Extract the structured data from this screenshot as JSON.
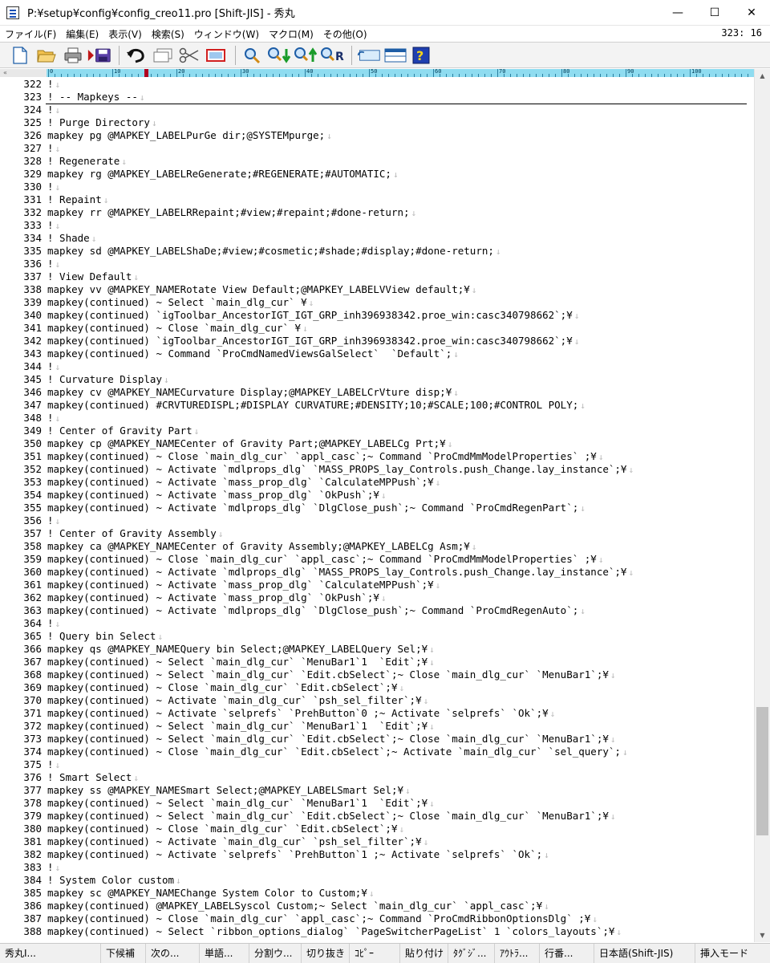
{
  "window": {
    "title": "P:¥setup¥config¥config_creo11.pro  [Shift-JIS] - 秀丸",
    "minimize": "—",
    "maximize": "☐",
    "close": "✕"
  },
  "menu": {
    "items": [
      "ファイル(F)",
      "編集(E)",
      "表示(V)",
      "検索(S)",
      "ウィンドウ(W)",
      "マクロ(M)",
      "その他(O)"
    ],
    "cursor_position": "323: 16"
  },
  "toolbar": {
    "icons": [
      "new-file-icon",
      "open-folder-icon",
      "print-icon",
      "save-icon",
      "undo-icon",
      "copy-icon",
      "cut-icon",
      "paste-icon",
      "search-icon",
      "search-down-icon",
      "search-up-icon",
      "replace-icon",
      "window-switch-icon",
      "window-split-icon",
      "help-icon"
    ]
  },
  "ruler": {
    "left_marker": "«",
    "labels": [
      "0",
      "10",
      "20",
      "30",
      "40",
      "50",
      "60",
      "70",
      "80",
      "90",
      "100"
    ]
  },
  "editor": {
    "eol_mark": "↓",
    "lines": [
      {
        "n": "322",
        "t": "!"
      },
      {
        "n": "323",
        "t": "! -- Mapkeys --"
      },
      {
        "n": "324",
        "t": "!"
      },
      {
        "n": "325",
        "t": "! Purge Directory"
      },
      {
        "n": "326",
        "t": "mapkey pg @MAPKEY_LABELPurGe dir;@SYSTEMpurge;"
      },
      {
        "n": "327",
        "t": "!"
      },
      {
        "n": "328",
        "t": "! Regenerate"
      },
      {
        "n": "329",
        "t": "mapkey rg @MAPKEY_LABELReGenerate;#REGENERATE;#AUTOMATIC;"
      },
      {
        "n": "330",
        "t": "!"
      },
      {
        "n": "331",
        "t": "! Repaint"
      },
      {
        "n": "332",
        "t": "mapkey rr @MAPKEY_LABELRRepaint;#view;#repaint;#done-return;"
      },
      {
        "n": "333",
        "t": "!"
      },
      {
        "n": "334",
        "t": "! Shade"
      },
      {
        "n": "335",
        "t": "mapkey sd @MAPKEY_LABELShaDe;#view;#cosmetic;#shade;#display;#done-return;"
      },
      {
        "n": "336",
        "t": "!"
      },
      {
        "n": "337",
        "t": "! View Default"
      },
      {
        "n": "338",
        "t": "mapkey vv @MAPKEY_NAMERotate View Default;@MAPKEY_LABELVView default;¥"
      },
      {
        "n": "339",
        "t": "mapkey(continued) ~ Select `main_dlg_cur` ¥"
      },
      {
        "n": "340",
        "t": "mapkey(continued) `igToolbar_AncestorIGT_IGT_GRP_inh396938342.proe_win:casc340798662`;¥"
      },
      {
        "n": "341",
        "t": "mapkey(continued) ~ Close `main_dlg_cur` ¥"
      },
      {
        "n": "342",
        "t": "mapkey(continued) `igToolbar_AncestorIGT_IGT_GRP_inh396938342.proe_win:casc340798662`;¥"
      },
      {
        "n": "343",
        "t": "mapkey(continued) ~ Command `ProCmdNamedViewsGalSelect`  `Default`;"
      },
      {
        "n": "344",
        "t": "!"
      },
      {
        "n": "345",
        "t": "! Curvature Display"
      },
      {
        "n": "346",
        "t": "mapkey cv @MAPKEY_NAMECurvature Display;@MAPKEY_LABELCrVture disp;¥"
      },
      {
        "n": "347",
        "t": "mapkey(continued) #CRVTUREDISPL;#DISPLAY CURVATURE;#DENSITY;10;#SCALE;100;#CONTROL POLY;"
      },
      {
        "n": "348",
        "t": "!"
      },
      {
        "n": "349",
        "t": "! Center of Gravity Part"
      },
      {
        "n": "350",
        "t": "mapkey cp @MAPKEY_NAMECenter of Gravity Part;@MAPKEY_LABELCg Prt;¥"
      },
      {
        "n": "351",
        "t": "mapkey(continued) ~ Close `main_dlg_cur` `appl_casc`;~ Command `ProCmdMmModelProperties` ;¥"
      },
      {
        "n": "352",
        "t": "mapkey(continued) ~ Activate `mdlprops_dlg` `MASS_PROPS_lay_Controls.push_Change.lay_instance`;¥"
      },
      {
        "n": "353",
        "t": "mapkey(continued) ~ Activate `mass_prop_dlg` `CalculateMPPush`;¥"
      },
      {
        "n": "354",
        "t": "mapkey(continued) ~ Activate `mass_prop_dlg` `OkPush`;¥"
      },
      {
        "n": "355",
        "t": "mapkey(continued) ~ Activate `mdlprops_dlg` `DlgClose_push`;~ Command `ProCmdRegenPart`;"
      },
      {
        "n": "356",
        "t": "!"
      },
      {
        "n": "357",
        "t": "! Center of Gravity Assembly"
      },
      {
        "n": "358",
        "t": "mapkey ca @MAPKEY_NAMECenter of Gravity Assembly;@MAPKEY_LABELCg Asm;¥"
      },
      {
        "n": "359",
        "t": "mapkey(continued) ~ Close `main_dlg_cur` `appl_casc`;~ Command `ProCmdMmModelProperties` ;¥"
      },
      {
        "n": "360",
        "t": "mapkey(continued) ~ Activate `mdlprops_dlg` `MASS_PROPS_lay_Controls.push_Change.lay_instance`;¥"
      },
      {
        "n": "361",
        "t": "mapkey(continued) ~ Activate `mass_prop_dlg` `CalculateMPPush`;¥"
      },
      {
        "n": "362",
        "t": "mapkey(continued) ~ Activate `mass_prop_dlg` `OkPush`;¥"
      },
      {
        "n": "363",
        "t": "mapkey(continued) ~ Activate `mdlprops_dlg` `DlgClose_push`;~ Command `ProCmdRegenAuto`;"
      },
      {
        "n": "364",
        "t": "!"
      },
      {
        "n": "365",
        "t": "! Query bin Select"
      },
      {
        "n": "366",
        "t": "mapkey qs @MAPKEY_NAMEQuery bin Select;@MAPKEY_LABELQuery Sel;¥"
      },
      {
        "n": "367",
        "t": "mapkey(continued) ~ Select `main_dlg_cur` `MenuBar1`1  `Edit`;¥"
      },
      {
        "n": "368",
        "t": "mapkey(continued) ~ Select `main_dlg_cur` `Edit.cbSelect`;~ Close `main_dlg_cur` `MenuBar1`;¥"
      },
      {
        "n": "369",
        "t": "mapkey(continued) ~ Close `main_dlg_cur` `Edit.cbSelect`;¥"
      },
      {
        "n": "370",
        "t": "mapkey(continued) ~ Activate `main_dlg_cur` `psh_sel_filter`;¥"
      },
      {
        "n": "371",
        "t": "mapkey(continued) ~ Activate `selprefs` `PrehButton`0 ;~ Activate `selprefs` `Ok`;¥"
      },
      {
        "n": "372",
        "t": "mapkey(continued) ~ Select `main_dlg_cur` `MenuBar1`1  `Edit`;¥"
      },
      {
        "n": "373",
        "t": "mapkey(continued) ~ Select `main_dlg_cur` `Edit.cbSelect`;~ Close `main_dlg_cur` `MenuBar1`;¥"
      },
      {
        "n": "374",
        "t": "mapkey(continued) ~ Close `main_dlg_cur` `Edit.cbSelect`;~ Activate `main_dlg_cur` `sel_query`;"
      },
      {
        "n": "375",
        "t": "!"
      },
      {
        "n": "376",
        "t": "! Smart Select"
      },
      {
        "n": "377",
        "t": "mapkey ss @MAPKEY_NAMESmart Select;@MAPKEY_LABELSmart Sel;¥"
      },
      {
        "n": "378",
        "t": "mapkey(continued) ~ Select `main_dlg_cur` `MenuBar1`1  `Edit`;¥"
      },
      {
        "n": "379",
        "t": "mapkey(continued) ~ Select `main_dlg_cur` `Edit.cbSelect`;~ Close `main_dlg_cur` `MenuBar1`;¥"
      },
      {
        "n": "380",
        "t": "mapkey(continued) ~ Close `main_dlg_cur` `Edit.cbSelect`;¥"
      },
      {
        "n": "381",
        "t": "mapkey(continued) ~ Activate `main_dlg_cur` `psh_sel_filter`;¥"
      },
      {
        "n": "382",
        "t": "mapkey(continued) ~ Activate `selprefs` `PrehButton`1 ;~ Activate `selprefs` `Ok`;"
      },
      {
        "n": "383",
        "t": "!"
      },
      {
        "n": "384",
        "t": "! System Color custom"
      },
      {
        "n": "385",
        "t": "mapkey sc @MAPKEY_NAMEChange System Color to Custom;¥"
      },
      {
        "n": "386",
        "t": "mapkey(continued) @MAPKEY_LABELSyscol Custom;~ Select `main_dlg_cur` `appl_casc`;¥"
      },
      {
        "n": "387",
        "t": "mapkey(continued) ~ Close `main_dlg_cur` `appl_casc`;~ Command `ProCmdRibbonOptionsDlg` ;¥"
      },
      {
        "n": "388",
        "t": "mapkey(continued) ~ Select `ribbon_options_dialog` `PageSwitcherPageList` 1 `colors_layouts`;¥"
      }
    ]
  },
  "statusbar": {
    "items": [
      "秀丸I...",
      "下候補",
      "次の...",
      "単語...",
      "分割ウ...",
      "切り抜き",
      "ｺﾋﾟｰ",
      "貼り付け",
      "ﾀｸﾞｼﾞ...",
      "ｱｳﾄﾗ...",
      "行番...",
      "日本語(Shift-JIS)",
      "挿入モード"
    ]
  },
  "colors": {
    "ruler": "#8fdcf0",
    "ruler_caret": "#b00020",
    "eol_mark": "#b9b9b9"
  }
}
